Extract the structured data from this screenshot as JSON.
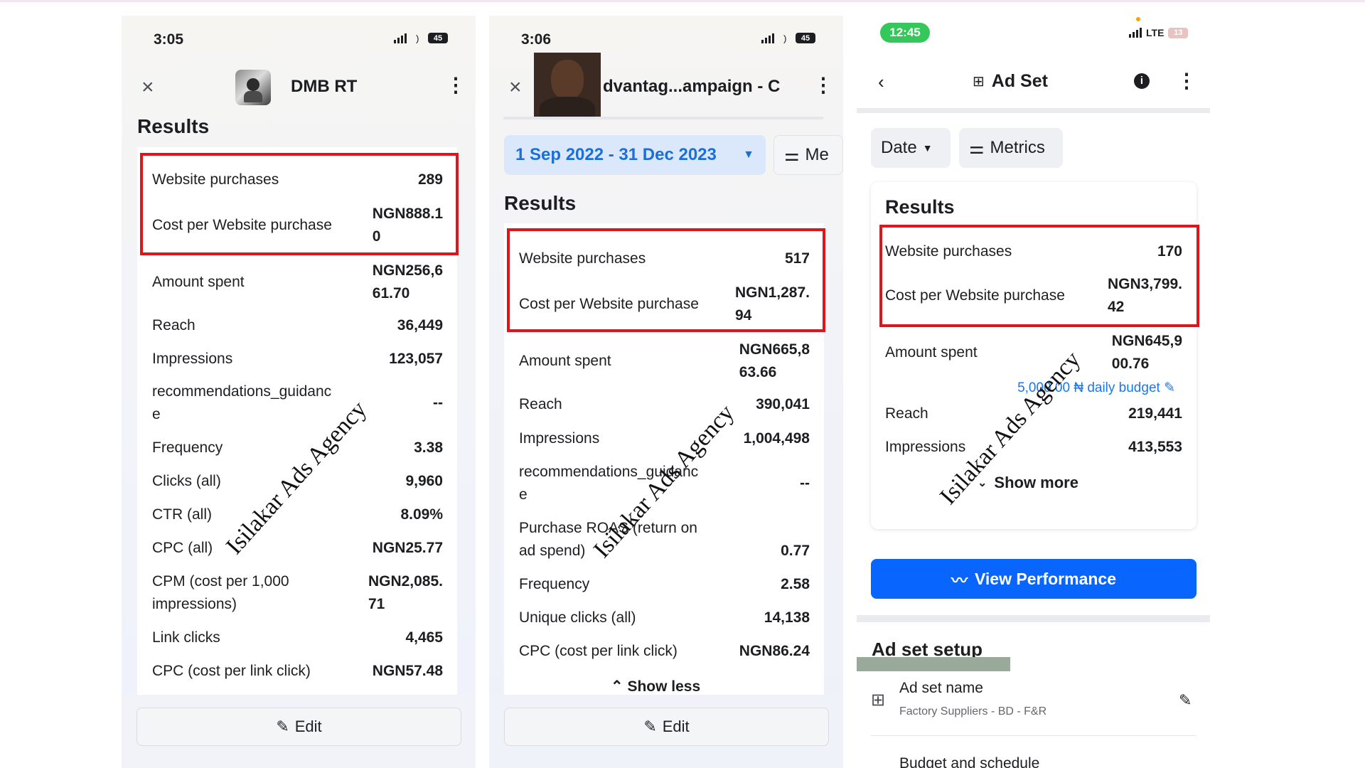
{
  "colors": {
    "highlight_red": "#e0141c",
    "meta_blue": "#0866ff",
    "date_blue": "#1b6fd8",
    "status_green": "#34c759"
  },
  "phone1": {
    "time": "3:05",
    "battery": "45",
    "title": "DMB RT",
    "results_heading": "Results",
    "rows": [
      {
        "label": "Website purchases",
        "value": "289"
      },
      {
        "label": "Cost per Website purchase",
        "value": "NGN888.1\n0"
      },
      {
        "label": "Amount spent",
        "value": "NGN256,6\n61.70"
      },
      {
        "label": "Reach",
        "value": "36,449"
      },
      {
        "label": "Impressions",
        "value": "123,057"
      },
      {
        "label": "recommendations_guidanc\ne",
        "value": "--"
      },
      {
        "label": "Frequency",
        "value": "3.38"
      },
      {
        "label": "Clicks (all)",
        "value": "9,960"
      },
      {
        "label": "CTR (all)",
        "value": "8.09%"
      },
      {
        "label": "CPC (all)",
        "value": "NGN25.77"
      },
      {
        "label": "CPM (cost per 1,000\nimpressions)",
        "value": "NGN2,085.\n71"
      },
      {
        "label": "Link clicks",
        "value": "4,465"
      },
      {
        "label": "CPC (cost per link click)",
        "value": "NGN57.48"
      }
    ],
    "edit_label": "Edit",
    "watermark": "Isilakar Ads Agency"
  },
  "phone2": {
    "time": "3:06",
    "battery": "45",
    "title": "dvantag...ampaign - C",
    "date_range": "1 Sep 2022 - 31 Dec 2023",
    "metrics_chip": "Me",
    "results_heading": "Results",
    "rows": [
      {
        "label": "Website purchases",
        "value": "517"
      },
      {
        "label": "Cost per Website purchase",
        "value": "NGN1,287.\n94"
      },
      {
        "label": "Amount spent",
        "value": "NGN665,8\n63.66"
      },
      {
        "label": "Reach",
        "value": "390,041"
      },
      {
        "label": "Impressions",
        "value": "1,004,498"
      },
      {
        "label": "recommendations_guidanc\ne",
        "value": "--"
      },
      {
        "label": "Purchase ROAS (return on\nad spend)",
        "value": "0.77"
      },
      {
        "label": "Frequency",
        "value": "2.58"
      },
      {
        "label": "Unique clicks (all)",
        "value": "14,138"
      },
      {
        "label": "CPC (cost per link click)",
        "value": "NGN86.24"
      }
    ],
    "show_less": "Show less",
    "edit_label": "Edit",
    "watermark": "Isilakar Ads Agency"
  },
  "phone3": {
    "time": "12:45",
    "network": "LTE",
    "battery": "13",
    "title": "Ad Set",
    "date_chip": "Date",
    "metrics_chip": "Metrics",
    "results_heading": "Results",
    "rows": [
      {
        "label": "Website purchases",
        "value": "170"
      },
      {
        "label": "Cost per Website purchase",
        "value": "NGN3,799.\n42"
      },
      {
        "label": "Amount spent",
        "value": "NGN645,9\n00.76"
      },
      {
        "label": "Reach",
        "value": "219,441"
      },
      {
        "label": "Impressions",
        "value": "413,553"
      }
    ],
    "daily_budget": "5,000.00 ₦ daily budget",
    "show_more": "Show more",
    "view_performance": "View Performance",
    "setup_heading": "Ad set setup",
    "ad_set_name_label": "Ad set name",
    "ad_set_name_value": "Factory Suppliers - BD - F&R",
    "budget_label": "Budget and schedule",
    "watermark": "Isilakar Ads Agency"
  }
}
